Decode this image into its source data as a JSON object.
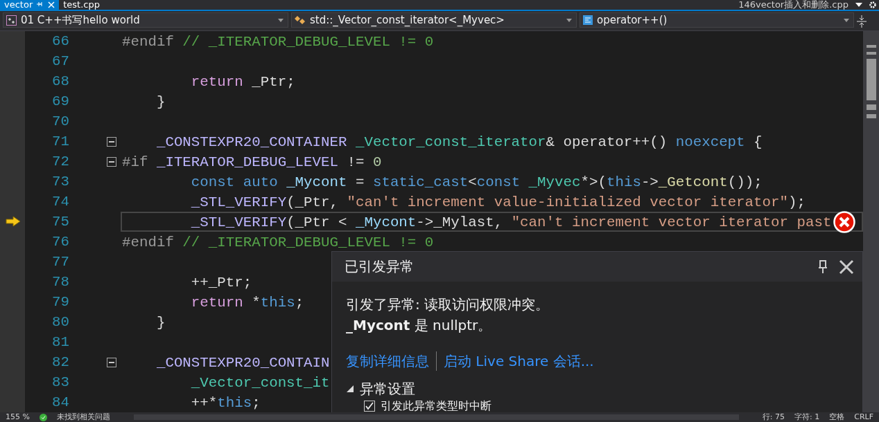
{
  "tabs": [
    {
      "label": "vector",
      "selected": true,
      "pinned": true
    },
    {
      "label": "test.cpp",
      "selected": false,
      "pinned": false
    }
  ],
  "tab_right": {
    "label": "146vector插入和删除.cpp"
  },
  "nav": {
    "project": "01 C++书写hello world",
    "scope": "std::_Vector_const_iterator<_Myvec>",
    "member": "operator++()"
  },
  "code_lines": [
    {
      "number": "66",
      "fold_button": false,
      "current": false,
      "tokens": [
        {
          "kind": "pre",
          "text": "#endif"
        },
        {
          "kind": "comment",
          "text": " // _ITERATOR_DEBUG_LEVEL != 0"
        }
      ]
    },
    {
      "number": "67",
      "fold_button": false,
      "current": false
    },
    {
      "number": "68",
      "fold_button": false,
      "current": false,
      "tokens": [
        {
          "kind": "control",
          "text": "        return"
        },
        {
          "kind": "plain",
          "text": " _Ptr;"
        }
      ]
    },
    {
      "number": "69",
      "fold_button": false,
      "current": false,
      "tokens": [
        {
          "kind": "plain",
          "text": "    }"
        }
      ]
    },
    {
      "number": "70",
      "fold_button": false,
      "current": false
    },
    {
      "number": "71",
      "fold_button": true,
      "current": false,
      "tokens": [
        {
          "kind": "macro",
          "text": "    _CONSTEXPR20_CONTAINER"
        },
        {
          "kind": "type",
          "text": " _Vector_const_iterator"
        },
        {
          "kind": "plain",
          "text": "& operator++() "
        },
        {
          "kind": "keyword",
          "text": "noexcept"
        },
        {
          "kind": "plain",
          "text": " {"
        }
      ]
    },
    {
      "number": "72",
      "fold_button": true,
      "current": false,
      "tokens": [
        {
          "kind": "pre",
          "text": "#if"
        },
        {
          "kind": "macro",
          "text": " _ITERATOR_DEBUG_LEVEL"
        },
        {
          "kind": "plain",
          "text": " != "
        },
        {
          "kind": "number",
          "text": "0"
        }
      ]
    },
    {
      "number": "73",
      "fold_button": false,
      "current": false,
      "tokens": [
        {
          "kind": "keyword",
          "text": "        const auto"
        },
        {
          "kind": "variable",
          "text": " _Mycont"
        },
        {
          "kind": "plain",
          "text": " = "
        },
        {
          "kind": "keyword",
          "text": "static_cast"
        },
        {
          "kind": "plain",
          "text": "<"
        },
        {
          "kind": "keyword",
          "text": "const"
        },
        {
          "kind": "type",
          "text": " _Myvec"
        },
        {
          "kind": "plain",
          "text": "*>("
        },
        {
          "kind": "keyword",
          "text": "this"
        },
        {
          "kind": "plain",
          "text": "->"
        },
        {
          "kind": "function",
          "text": "_Getcont"
        },
        {
          "kind": "plain",
          "text": "());"
        }
      ]
    },
    {
      "number": "74",
      "fold_button": false,
      "current": false,
      "tokens": [
        {
          "kind": "macro",
          "text": "        _STL_VERIFY"
        },
        {
          "kind": "plain",
          "text": "(_Ptr, "
        },
        {
          "kind": "string",
          "text": "\"can't increment value-initialized vector iterator\""
        },
        {
          "kind": "plain",
          "text": ");"
        }
      ]
    },
    {
      "number": "75",
      "fold_button": false,
      "current": true,
      "tokens": [
        {
          "kind": "macro",
          "text": "        _STL_VERIFY"
        },
        {
          "kind": "plain",
          "text": "(_Ptr < "
        },
        {
          "kind": "variable",
          "text": "_Mycont"
        },
        {
          "kind": "plain",
          "text": "->_Mylast, "
        },
        {
          "kind": "string",
          "text": "\"can't increment vector iterator past"
        }
      ]
    },
    {
      "number": "76",
      "fold_button": false,
      "current": false,
      "tokens": [
        {
          "kind": "pre",
          "text": "#endif"
        },
        {
          "kind": "comment",
          "text": " // _ITERATOR_DEBUG_LEVEL != 0"
        }
      ]
    },
    {
      "number": "77",
      "fold_button": false,
      "current": false
    },
    {
      "number": "78",
      "fold_button": false,
      "current": false,
      "tokens": [
        {
          "kind": "plain",
          "text": "        ++_Ptr;"
        }
      ]
    },
    {
      "number": "79",
      "fold_button": false,
      "current": false,
      "tokens": [
        {
          "kind": "control",
          "text": "        return"
        },
        {
          "kind": "plain",
          "text": " *"
        },
        {
          "kind": "keyword",
          "text": "this"
        },
        {
          "kind": "plain",
          "text": ";"
        }
      ]
    },
    {
      "number": "80",
      "fold_button": false,
      "current": false,
      "tokens": [
        {
          "kind": "plain",
          "text": "    }"
        }
      ]
    },
    {
      "number": "81",
      "fold_button": false,
      "current": false
    },
    {
      "number": "82",
      "fold_button": true,
      "current": false,
      "tokens": [
        {
          "kind": "macro",
          "text": "    _CONSTEXPR20_CONTAIN"
        }
      ]
    },
    {
      "number": "83",
      "fold_button": false,
      "current": false,
      "tokens": [
        {
          "kind": "type",
          "text": "        _Vector_const_it"
        }
      ]
    },
    {
      "number": "84",
      "fold_button": false,
      "current": false,
      "tokens": [
        {
          "kind": "plain",
          "text": "        ++*"
        },
        {
          "kind": "keyword",
          "text": "this"
        },
        {
          "kind": "plain",
          "text": ";"
        }
      ]
    }
  ],
  "exception_popup": {
    "title": "已引发异常",
    "message": "引发了异常: 读取访问权限冲突。",
    "detail": "**_Mycont** 是 nullptr。",
    "links": [
      "复制详细信息",
      "启动 Live Share 会话..."
    ],
    "settings": {
      "label": "异常设置",
      "expanded": true,
      "option": {
        "label": "引发此异常类型时中断",
        "checked": true
      }
    }
  },
  "status_bar": {
    "zoom": "155 %",
    "issues": "未找到相关问题",
    "line": "行: 75",
    "char": "字符: 1",
    "indent": "空格",
    "eol": "CRLF"
  }
}
